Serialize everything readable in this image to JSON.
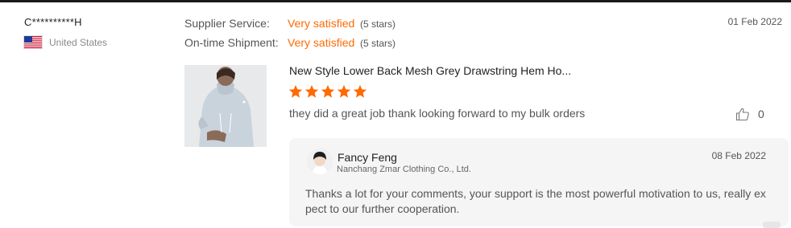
{
  "reviewer": {
    "name": "C**********H",
    "country": "United States",
    "flag_icon": "us-flag-icon"
  },
  "ratings": [
    {
      "label": "Supplier Service:",
      "value": "Very satisfied",
      "stars": "(5 stars)"
    },
    {
      "label": "On-time Shipment:",
      "value": "Very satisfied",
      "stars": "(5 stars)"
    }
  ],
  "review_date": "01 Feb 2022",
  "product": {
    "title": "New Style Lower Back Mesh Grey Drawstring Hem Ho...",
    "image_icon": "product-thumbnail-icon"
  },
  "star_rating": 5,
  "review_text": "they did a great job thank looking forward to my bulk orders",
  "likes": "0",
  "reply": {
    "seller_name": "Fancy Feng",
    "company": "Nanchang Zmar Clothing Co., Ltd.",
    "date": "08 Feb 2022",
    "text": "Thanks a lot for your comments, your support is the most powerful motivation to us, really expect to our further cooperation."
  },
  "colors": {
    "accent": "#ff6a00",
    "star": "#ff6a00",
    "reply_bg": "#f5f5f5"
  }
}
